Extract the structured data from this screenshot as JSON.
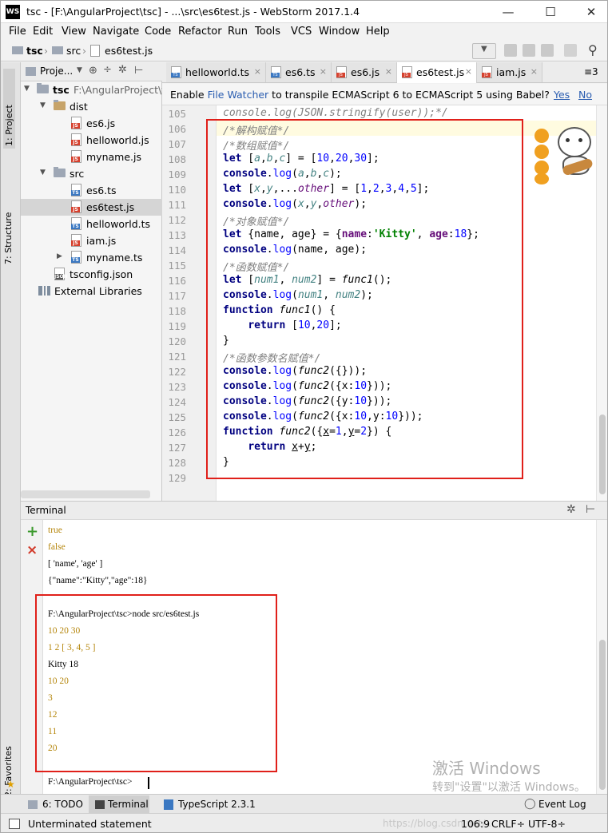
{
  "window": {
    "title": "tsc - [F:\\AngularProject\\tsc] - ...\\src\\es6test.js - WebStorm 2017.1.4",
    "app_icon": "WS"
  },
  "menu": [
    "File",
    "Edit",
    "View",
    "Navigate",
    "Code",
    "Refactor",
    "Run",
    "Tools",
    "VCS",
    "Window",
    "Help"
  ],
  "breadcrumb": [
    "tsc",
    "src",
    "es6test.js"
  ],
  "project_panel": {
    "header": "Proje...",
    "items": [
      {
        "label": "tsc",
        "path": "F:\\AngularProject\\t",
        "type": "root"
      },
      {
        "label": "dist",
        "type": "folder"
      },
      {
        "label": "es6.js",
        "type": "js"
      },
      {
        "label": "helloworld.js",
        "type": "js"
      },
      {
        "label": "myname.js",
        "type": "js"
      },
      {
        "label": "src",
        "type": "folder"
      },
      {
        "label": "es6.ts",
        "type": "ts"
      },
      {
        "label": "es6test.js",
        "type": "js"
      },
      {
        "label": "helloworld.ts",
        "type": "ts"
      },
      {
        "label": "iam.js",
        "type": "js"
      },
      {
        "label": "myname.ts",
        "type": "ts"
      },
      {
        "label": "tsconfig.json",
        "type": "json"
      },
      {
        "label": "External Libraries",
        "type": "lib"
      }
    ]
  },
  "side_tabs": {
    "project": "1: Project",
    "structure": "7: Structure",
    "favorites": "2: Favorites"
  },
  "editor_tabs": [
    {
      "label": "helloworld.ts",
      "type": "ts"
    },
    {
      "label": "es6.ts",
      "type": "ts"
    },
    {
      "label": "es6.js",
      "type": "js"
    },
    {
      "label": "es6test.js",
      "type": "js",
      "active": true
    },
    {
      "label": "iam.js",
      "type": "js"
    },
    {
      "label": "≡3",
      "type": "more"
    }
  ],
  "notification": {
    "text_before": "Enable ",
    "link": "File Watcher",
    "text_after": " to transpile ECMAScript 6 to ECMAScript 5 using Babel?",
    "yes": "Yes",
    "no": "No"
  },
  "code_lines": [
    {
      "n": "105",
      "html": "<span class=\"cm\">console.log(JSON.stringify(user));*/</span>"
    },
    {
      "n": "106",
      "html": "<span class=\"cm\">/*解构赋值*/</span>"
    },
    {
      "n": "107",
      "html": "<span class=\"cm\">/*数组赋值*/</span>"
    },
    {
      "n": "108",
      "html": "<span class=\"kw\">let</span> [<span class=\"vr\">a</span>,<span class=\"vr\">b</span>,<span class=\"vr\">c</span>] = [<span class=\"nm\">10</span>,<span class=\"nm\">20</span>,<span class=\"nm\">30</span>];"
    },
    {
      "n": "109",
      "html": "<span class=\"kw\">console</span>.<span class=\"nm\">log</span>(<span class=\"vr\">a</span>,<span class=\"vr\">b</span>,<span class=\"vr\">c</span>);"
    },
    {
      "n": "110",
      "html": "<span class=\"kw\">let</span> [<span class=\"vr\">x</span>,<span class=\"vr\">y</span>,...<span class=\"cn\">other</span>] = [<span class=\"nm\">1</span>,<span class=\"nm\">2</span>,<span class=\"nm\">3</span>,<span class=\"nm\">4</span>,<span class=\"nm\">5</span>];"
    },
    {
      "n": "111",
      "html": "<span class=\"kw\">console</span>.<span class=\"nm\">log</span>(<span class=\"vr\">x</span>,<span class=\"vr\">y</span>,<span class=\"cn\">other</span>);"
    },
    {
      "n": "112",
      "html": "<span class=\"cm\">/*对象赋值*/</span>"
    },
    {
      "n": "113",
      "html": "<span class=\"kw\">let</span> {name, age} = {<span class=\"pr\">name</span>:<span class=\"str\">'Kitty'</span>, <span class=\"pr\">age</span>:<span class=\"nm\">18</span>};"
    },
    {
      "n": "114",
      "html": "<span class=\"kw\">console</span>.<span class=\"nm\">log</span>(name, age);"
    },
    {
      "n": "115",
      "html": "<span class=\"cm\">/*函数赋值*/</span>"
    },
    {
      "n": "116",
      "html": "<span class=\"kw\">let</span> [<span class=\"vr\">num1</span>, <span class=\"vr\">num2</span>] = <span class=\"fn\">func1</span>();"
    },
    {
      "n": "117",
      "html": "<span class=\"kw\">console</span>.<span class=\"nm\">log</span>(<span class=\"vr\">num1</span>, <span class=\"vr\">num2</span>);"
    },
    {
      "n": "118",
      "html": "<span class=\"kw\">function</span> <span class=\"fn\">func1</span>() {"
    },
    {
      "n": "119",
      "html": "    <span class=\"kw\">return</span> [<span class=\"nm\">10</span>,<span class=\"nm\">20</span>];"
    },
    {
      "n": "120",
      "html": "}"
    },
    {
      "n": "121",
      "html": "<span class=\"cm\">/*函数参数名赋值*/</span>"
    },
    {
      "n": "122",
      "html": "<span class=\"kw\">console</span>.<span class=\"nm\">log</span>(<span class=\"fn\">func2</span>({}));"
    },
    {
      "n": "123",
      "html": "<span class=\"kw\">console</span>.<span class=\"nm\">log</span>(<span class=\"fn\">func2</span>({x:<span class=\"nm\">10</span>}));"
    },
    {
      "n": "124",
      "html": "<span class=\"kw\">console</span>.<span class=\"nm\">log</span>(<span class=\"fn\">func2</span>({y:<span class=\"nm\">10</span>}));"
    },
    {
      "n": "125",
      "html": "<span class=\"kw\">console</span>.<span class=\"nm\">log</span>(<span class=\"fn\">func2</span>({x:<span class=\"nm\">10</span>,y:<span class=\"nm\">10</span>}));"
    },
    {
      "n": "126",
      "html": "<span class=\"kw\">function</span> <span class=\"fn\">func2</span>({<u>x</u>=<span class=\"nm\">1</span>,<u>y</u>=<span class=\"nm\">2</span>}) {"
    },
    {
      "n": "127",
      "html": "    <span class=\"kw\">return</span> <u>x</u>+<u>y</u>;"
    },
    {
      "n": "128",
      "html": "}"
    },
    {
      "n": "129",
      "html": ""
    }
  ],
  "terminal": {
    "title": "Terminal",
    "lines": [
      {
        "text": "true",
        "cls": "tyel"
      },
      {
        "text": "false",
        "cls": "tyel"
      },
      {
        "text": "[ 'name', 'age' ]",
        "cls": ""
      },
      {
        "text": "{\"name\":\"Kitty\",\"age\":18}",
        "cls": ""
      },
      {
        "text": "",
        "cls": ""
      },
      {
        "text": "F:\\AngularProject\\tsc>node src/es6test.js",
        "cls": ""
      },
      {
        "text": "10 20 30",
        "cls": "tyel"
      },
      {
        "text": "1 2 [ 3, 4, 5 ]",
        "cls": "tyel"
      },
      {
        "text": "Kitty 18",
        "cls": ""
      },
      {
        "text": "10 20",
        "cls": "tyel"
      },
      {
        "text": "3",
        "cls": "tyel"
      },
      {
        "text": "12",
        "cls": "tyel"
      },
      {
        "text": "11",
        "cls": "tyel"
      },
      {
        "text": "20",
        "cls": "tyel"
      },
      {
        "text": "",
        "cls": ""
      },
      {
        "text": "F:\\AngularProject\\tsc>",
        "cls": ""
      }
    ]
  },
  "bottom_tools": {
    "todo": "6: TODO",
    "terminal": "Terminal",
    "typescript": "TypeScript 2.3.1",
    "event_log": "Event Log"
  },
  "status": {
    "message": "Unterminated statement",
    "position": "106:9",
    "line_sep": "CRLF÷",
    "encoding": "UTF-8÷",
    "url_wm": "https://blog.csdn.net/..."
  },
  "watermark": {
    "line1": "激活 Windows",
    "line2": "转到\"设置\"以激活 Windows。"
  },
  "colors": {
    "highlight_box": "#e0201a",
    "keyword": "#000080",
    "number": "#0000ff",
    "string": "#008000"
  }
}
